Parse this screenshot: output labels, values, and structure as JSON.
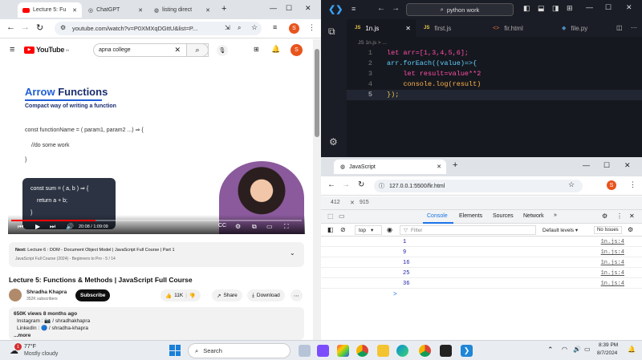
{
  "chrome": {
    "tabs": [
      {
        "label": "Lecture 5: Fu",
        "active": true,
        "icon": "youtube-icon"
      },
      {
        "label": "ChatGPT",
        "icon": "chatgpt-icon"
      },
      {
        "label": "listing direct",
        "icon": "globe-icon"
      }
    ],
    "url": "youtube.com/watch?v=P0XMXqDGttU&list=P...",
    "profile_initial": "S"
  },
  "youtube": {
    "logo_text": "YouTube",
    "logo_sup": "IN",
    "search_value": "apna college",
    "notif_count": "9+",
    "slide": {
      "title_1": "Arrow",
      "title_2": "Functions",
      "subtitle": "Compact way of writing a function",
      "syntax": "const functionName = ( param1, param2 ...) ⇒ {",
      "body": "//do some work",
      "close": "}",
      "overlay_line1": "const sum = ( a, b ) ⇒ {",
      "overlay_line2": "return a + b;",
      "overlay_line3": "}"
    },
    "time": "20:08 / 1:09:09",
    "next_label": "Next:",
    "next_title": "Lecture 6 : DOM - Document Object Model | JavaScript Full Course | Part 1",
    "next_playlist": "JavaScript Full Course (2024) - Beginners to Pro - 5 / 14",
    "video_title": "Lecture 5: Functions & Methods | JavaScript Full Course",
    "channel": "Shradha Khapra",
    "subscribers": "352K subscribers",
    "subscribe": "Subscribe",
    "likes": "11K",
    "share": "Share",
    "download": "Download",
    "views": "650K views  8 months ago",
    "desc_instagram": "Instagram :  📷 / shradhakhapra",
    "desc_linkedin": "LinkedIn :  🔵 / shradha-khapra",
    "more": "...more"
  },
  "vscode": {
    "search": "python work",
    "tabs": [
      "1n.js",
      "first.js",
      "fir.html",
      "file.py"
    ],
    "breadcrumb": "JS 1n.js > ...",
    "code": [
      {
        "n": "1",
        "t": "let arr=[1,3,4,5,6];"
      },
      {
        "n": "2",
        "t": "arr.forEach((value)=>{"
      },
      {
        "n": "3",
        "t": "    let result=value**2"
      },
      {
        "n": "4",
        "t": "    console.log(result)"
      },
      {
        "n": "5",
        "t": "});"
      }
    ]
  },
  "devtools": {
    "tab_title": "JavaScript",
    "url": "127.0.0.1:5500/fir.html",
    "dims_w": "412",
    "dims_h": "915",
    "panels": [
      "Console",
      "Elements",
      "Sources",
      "Network"
    ],
    "context": "top",
    "filter_placeholder": "Filter",
    "levels": "Default levels",
    "issues": "No Issues",
    "logs": [
      {
        "v": "1",
        "src": "1n.js:4"
      },
      {
        "v": "9",
        "src": "1n.js:4"
      },
      {
        "v": "16",
        "src": "1n.js:4"
      },
      {
        "v": "25",
        "src": "1n.js:4"
      },
      {
        "v": "36",
        "src": "1n.js:4"
      }
    ],
    "prompt": ">"
  },
  "taskbar": {
    "weather_temp": "77°F",
    "weather_desc": "Mostly cloudy",
    "weather_badge": "1",
    "search": "Search",
    "time": "8:39 PM",
    "date": "8/7/2024"
  }
}
